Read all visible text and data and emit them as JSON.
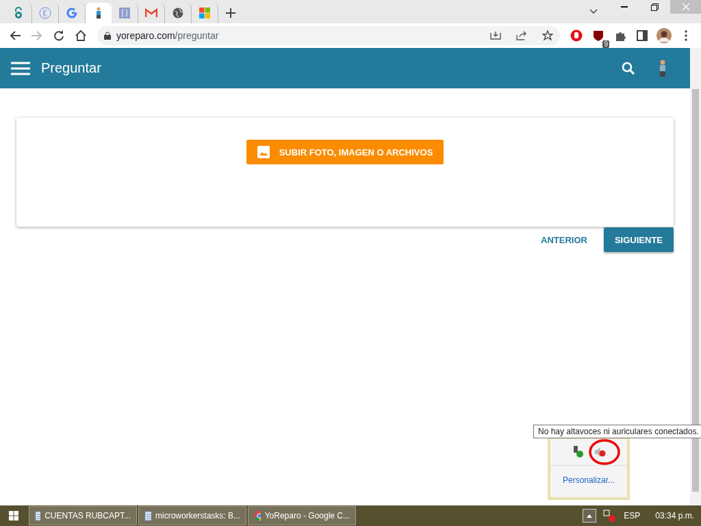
{
  "browser": {
    "tabs": [
      {
        "selected": false
      },
      {
        "selected": false
      },
      {
        "selected": false
      },
      {
        "selected": true
      },
      {
        "selected": false
      },
      {
        "selected": false
      },
      {
        "selected": false
      },
      {
        "selected": false
      }
    ],
    "url_domain": "yoreparo.com",
    "url_path": "/preguntar",
    "extension_badge": "9"
  },
  "app_bar": {
    "title": "Preguntar"
  },
  "upload_button": "SUBIR FOTO, IMAGEN O ARCHIVOS",
  "nav": {
    "back": "ANTERIOR",
    "next": "SIGUIENTE"
  },
  "tooltip": "No hay altavoces ni auriculares conectados.",
  "tray_popup": {
    "customize_link": "Personalizar..."
  },
  "taskbar": {
    "items": [
      {
        "label": "CUENTAS RUBCAPT...",
        "kind": "notepad"
      },
      {
        "label": "microworkerstasks: B...",
        "kind": "notepad"
      },
      {
        "label": "YoReparo - Google C...",
        "kind": "chrome"
      }
    ],
    "language": "ESP",
    "clock": "03:34 p.m."
  }
}
